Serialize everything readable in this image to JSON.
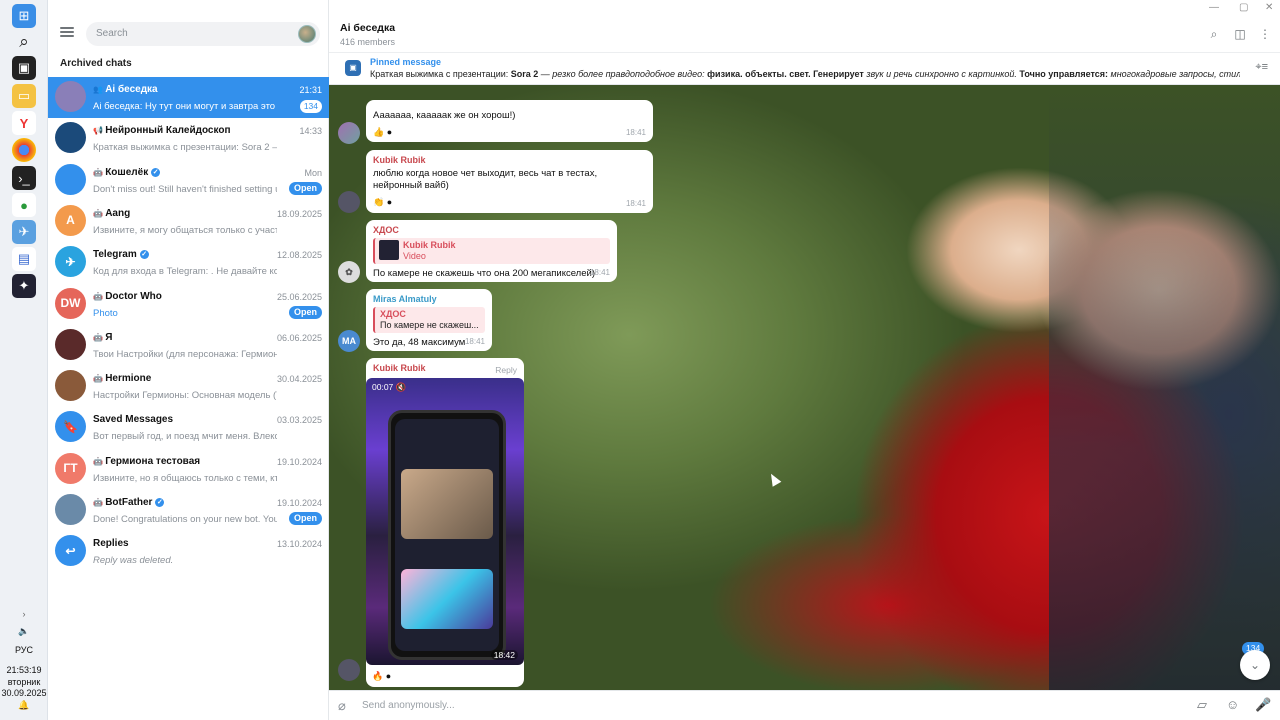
{
  "taskbar": {
    "lang": "РУС",
    "time": "21:53:19",
    "day": "вторник",
    "date": "30.09.2025"
  },
  "sidebar": {
    "search_placeholder": "Search",
    "section_title": "Archived chats",
    "chats": [
      {
        "name": "Ai беседка",
        "time": "21:31",
        "preview": "Ai беседка: Ну тут они могут и завтра это выкат...",
        "badge": "134",
        "icon": "group-icon",
        "avatar_color": "#8a7fb8"
      },
      {
        "name": "Нейронный Калейдоскоп",
        "time": "14:33",
        "preview": "Краткая выжимка с презентации: Sora 2 — резко б...",
        "icon": "channel-icon",
        "avatar_color": "#1b4a7a"
      },
      {
        "name": "Кошелёк",
        "time": "Mon",
        "preview": "Don't miss out!  Still haven't finished setting up?...",
        "open": "Open",
        "icon": "bot-icon",
        "avatar_color": "#3390ec"
      },
      {
        "name": "Aang",
        "time": "18.09.2025",
        "preview": "Извините, я могу общаться только с участниками р...",
        "icon": "bot-icon",
        "avatar_color": "#f39a4c",
        "initials": "A"
      },
      {
        "name": "Telegram",
        "time": "12.08.2025",
        "preview": "Код для входа в Telegram: . Не давайте код никому...",
        "icon": "verified-icon",
        "avatar_color": "#2aa3df"
      },
      {
        "name": "Doctor Who",
        "time": "25.06.2025",
        "preview": "Photo",
        "open": "Open",
        "icon": "bot-icon",
        "avatar_color": "#e5665a",
        "initials": "DW"
      },
      {
        "name": "Я",
        "time": "06.06.2025",
        "preview": "Твои Настройки (для персонажа: Гермиона Грейн...",
        "icon": "bot-icon",
        "avatar_color": "#5a2a2a"
      },
      {
        "name": "Hermione",
        "time": "30.04.2025",
        "preview": "Настройки Гермионы: Основная модель (Текст): ...",
        "icon": "bot-icon",
        "avatar_color": "#8a5a3a"
      },
      {
        "name": "Saved Messages",
        "time": "03.03.2025",
        "preview": "Вот первый год, и поезд мчит меня. Влекома тайной, ...",
        "avatar_color": "#3390ec"
      },
      {
        "name": "Гермиона тестовая",
        "time": "19.10.2024",
        "preview": "Извините, но я общаюсь только с теми, кто состоит в...",
        "icon": "bot-icon",
        "avatar_color": "#f07a6a",
        "initials": "ГТ"
      },
      {
        "name": "BotFather",
        "time": "19.10.2024",
        "preview": "Done! Congratulations on your new bot. You wi...",
        "open": "Open",
        "icon": "bot-icon",
        "avatar_color": "#6a8aa8"
      },
      {
        "name": "Replies",
        "time": "13.10.2024",
        "preview": "Reply was deleted.",
        "avatar_color": "#3390ec"
      }
    ]
  },
  "header": {
    "title": "Ai беседка",
    "members": "416 members"
  },
  "pinned": {
    "label": "Pinned message",
    "text_start": "Краткая выжимка с презентации: ",
    "sora": "Sora 2",
    "text_it1": " — резко более правдоподобное видео: ",
    "bold1": "физика. объекты. свет. Генерирует",
    "text_it2": " звук и речь синхронно с картинкой. ",
    "bold2": "Точно управляется:",
    "text_it3": " многокадровые запросы, стили от к..."
  },
  "messages": [
    {
      "text": "Ааааааа, кааааак же он хорош!)",
      "time": "18:41",
      "reactions": "👍"
    },
    {
      "sender": "Kubik Rubik",
      "text": "люблю когда новое чет выходит, весь чат в тестах, нейронный вайб)",
      "time": "18:41",
      "reactions": "👏"
    },
    {
      "sender": "ХДОС",
      "quote_name": "Kubik Rubik",
      "quote_text": "Video",
      "text": "По камере не скажешь что она 200 мегапикселей)",
      "time": "18:41"
    },
    {
      "sender": "Miras Almatuly",
      "quote_name": "ХДОС",
      "quote_text": "По камере не скажеш...",
      "text": "Это да, 48 максимум",
      "time": "18:41",
      "avatar": "MA"
    },
    {
      "sender": "Kubik Rubik",
      "reply": "Reply",
      "video_time": "00:07",
      "video_duration": "18:42",
      "reactions": "🔥"
    }
  ],
  "composer": {
    "placeholder": "Send anonymously..."
  },
  "unread_count": "134",
  "colors": {
    "accent": "#3390ec",
    "quote_red": "#d84e5c"
  }
}
